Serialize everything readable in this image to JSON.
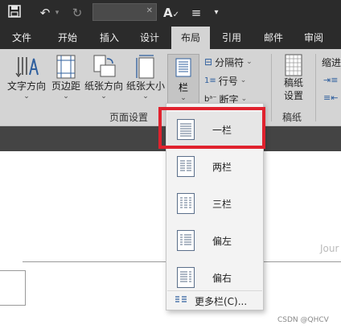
{
  "quick_access": {
    "save_icon": "save-icon",
    "undo_icon": "undo-icon",
    "redo_icon": "redo-icon",
    "font_icon": "spell-check-icon",
    "list_icon": "list-icon",
    "more_icon": "more-icon"
  },
  "tabs": [
    "文件",
    "开始",
    "插入",
    "设计",
    "布局",
    "引用",
    "邮件",
    "审阅"
  ],
  "active_tab": "布局",
  "ribbon": {
    "text_direction": "文字方向",
    "margins": "页边距",
    "orientation": "纸张方向",
    "size": "纸张大小",
    "columns": "栏",
    "page_setup_group": "页面设置",
    "breaks": "分隔符",
    "line_numbers": "行号",
    "hyphenation": "断字",
    "draft_paper_line1": "稿纸",
    "draft_paper_line2": "设置",
    "draft_group": "稿纸",
    "indent_label": "缩进"
  },
  "columns_menu": {
    "items": [
      "一栏",
      "两栏",
      "三栏",
      "偏左",
      "偏右"
    ],
    "more": "更多栏(C)..."
  },
  "document": {
    "partial_text": "Jour"
  },
  "watermark": "CSDN @QHCV",
  "colors": {
    "highlight": "#e0222e",
    "titlebar": "#2b2b2b",
    "ribbon": "#d4d4d4",
    "icon_blue": "#2f5f9e"
  }
}
